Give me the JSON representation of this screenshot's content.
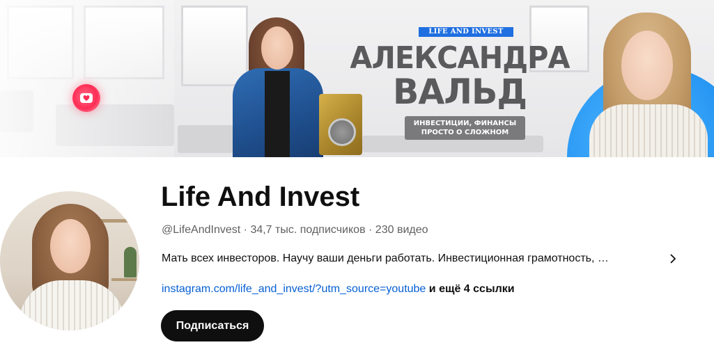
{
  "banner": {
    "tag": "LIFE AND INVEST",
    "name_line1": "АЛЕКСАНДРА",
    "name_line2": "ВАЛЬД",
    "subtitle_line1": "ИНВЕСТИЦИИ, ФИНАНСЫ",
    "subtitle_line2": "ПРОСТО О СЛОЖНОМ",
    "colors": {
      "tag_bg": "#1f6fe0",
      "subtitle_bg": "#7a7a7d",
      "accent_circle": "#1e8ff0"
    }
  },
  "channel": {
    "title": "Life And Invest",
    "handle": "@LifeAndInvest",
    "separator": "·",
    "subscribers": "34,7 тыс. подписчиков",
    "videos": "230 видео",
    "description": "Мать всех инвесторов. Научу ваши деньги работать. Инвестиционная грамотность, …",
    "link": "instagram.com/life_and_invest/?utm_source=youtube",
    "more_links": "и ещё 4 ссылки",
    "subscribe_label": "Подписаться"
  },
  "icons": {
    "description_expand": "chevron-right-icon",
    "banner_badge": "heart-badge-icon"
  }
}
